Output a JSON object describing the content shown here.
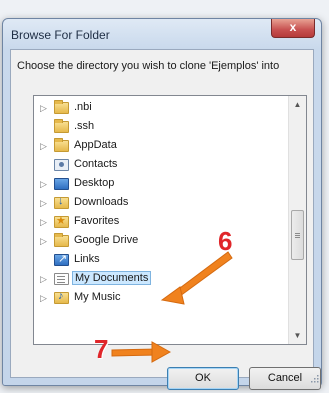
{
  "dialog": {
    "title": "Browse For Folder",
    "close_label": "x",
    "instruction": "Choose the directory you wish to clone 'Ejemplos' into",
    "ok_label": "OK",
    "cancel_label": "Cancel"
  },
  "tree": {
    "items": [
      {
        "label": ".nbi",
        "icon": "folder-icon",
        "expandable": true,
        "selected": false
      },
      {
        "label": ".ssh",
        "icon": "folder-icon",
        "expandable": false,
        "selected": false
      },
      {
        "label": "AppData",
        "icon": "folder-icon",
        "expandable": true,
        "selected": false
      },
      {
        "label": "Contacts",
        "icon": "contacts-folder-icon",
        "expandable": false,
        "selected": false
      },
      {
        "label": "Desktop",
        "icon": "desktop-folder-icon",
        "expandable": true,
        "selected": false
      },
      {
        "label": "Downloads",
        "icon": "downloads-folder-icon",
        "expandable": true,
        "selected": false
      },
      {
        "label": "Favorites",
        "icon": "favorites-folder-icon",
        "expandable": true,
        "selected": false
      },
      {
        "label": "Google Drive",
        "icon": "folder-icon",
        "expandable": true,
        "selected": false
      },
      {
        "label": "Links",
        "icon": "links-folder-icon",
        "expandable": false,
        "selected": false
      },
      {
        "label": "My Documents",
        "icon": "documents-folder-icon",
        "expandable": true,
        "selected": true
      },
      {
        "label": "My Music",
        "icon": "music-folder-icon",
        "expandable": true,
        "selected": false
      }
    ]
  },
  "annotations": {
    "step_6": "6",
    "step_7": "7",
    "arrow_color": "#f0821e",
    "marker_color": "#e0262a"
  }
}
